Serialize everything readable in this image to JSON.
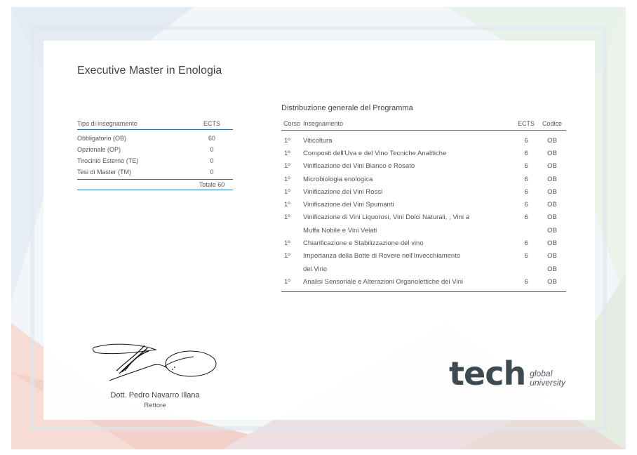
{
  "title": "Executive Master in Enologia",
  "left_table": {
    "header": {
      "type": "Tipo di insegnamento",
      "ects": "ECTS"
    },
    "rows": [
      {
        "type": "Obbligatorio (OB)",
        "ects": "60"
      },
      {
        "type": "Opzionale (OP)",
        "ects": "0"
      },
      {
        "type": "Tirocinio Esterno (TE)",
        "ects": "0"
      },
      {
        "type": "Tesi di Master (TM)",
        "ects": "0"
      }
    ],
    "total": "Totale 60"
  },
  "right_table": {
    "title": "Distribuzione generale del Programma",
    "header": {
      "corso": "Corso",
      "insegnamento": "Insegnamento",
      "ects": "ECTS",
      "codice": "Codice"
    },
    "rows": [
      {
        "corso": "1º",
        "insegnamento": "Viticoltura",
        "ects": "6",
        "codice": "OB"
      },
      {
        "corso": "1º",
        "insegnamento": "Composti dell'Uva e del Vino Tecniche Analitiche",
        "ects": "6",
        "codice": "OB"
      },
      {
        "corso": "1º",
        "insegnamento": "Vinificazione dei Vini Bianco e Rosato",
        "ects": "6",
        "codice": "OB"
      },
      {
        "corso": "1º",
        "insegnamento": "Microbiologia enologica",
        "ects": "6",
        "codice": "OB"
      },
      {
        "corso": "1º",
        "insegnamento": "Vinificazione dei Vini Rossi",
        "ects": "6",
        "codice": "OB"
      },
      {
        "corso": "1º",
        "insegnamento": "Vinificazione dei Vini Spumanti",
        "ects": "6",
        "codice": "OB"
      },
      {
        "corso": "1º",
        "insegnamento": "Vinificazione di Vini Liquorosi, Vini Dolci Naturali, , Vini a",
        "ects": "6",
        "codice": "OB"
      },
      {
        "corso": "",
        "insegnamento": "Muffa Nobile e Vini Velati",
        "ects": "",
        "codice": "OB"
      },
      {
        "corso": "1º",
        "insegnamento": "Chiarificazione e Stabilizzazione del vino",
        "ects": "6",
        "codice": "OB"
      },
      {
        "corso": "1º",
        "insegnamento": "Importanza della Botte di Rovere nell'Invecchiamento",
        "ects": "6",
        "codice": "OB"
      },
      {
        "corso": "",
        "insegnamento": "del Vino",
        "ects": "",
        "codice": "OB"
      },
      {
        "corso": "1º",
        "insegnamento": "Analisi Sensoriale e Alterazioni Organolettiche dei Vini",
        "ects": "6",
        "codice": "OB"
      }
    ]
  },
  "signature": {
    "name": "Dott. Pedro Navarro Illana",
    "role": "Rettore"
  },
  "logo": {
    "brand": "tech",
    "tagline_1": "global",
    "tagline_2": "university"
  },
  "colors": {
    "accent_line": "#2a6fa8",
    "logo_text": "#3d4a52"
  }
}
